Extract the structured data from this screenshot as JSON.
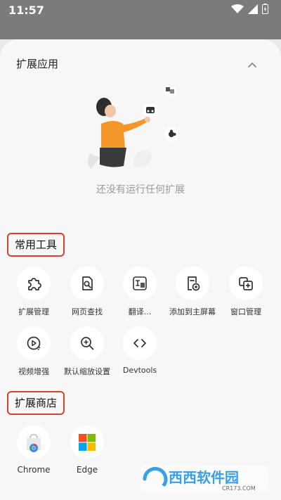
{
  "status": {
    "time": "11:57"
  },
  "panel": {
    "title": "扩展应用",
    "empty_message": "还没有运行任何扩展"
  },
  "common_tools": {
    "title": "常用工具",
    "items": [
      {
        "label": "扩展管理",
        "icon": "puzzle-icon"
      },
      {
        "label": "网页查找",
        "icon": "page-search-icon"
      },
      {
        "label": "翻译...",
        "icon": "translate-icon"
      },
      {
        "label": "添加到主屏幕",
        "icon": "add-to-home-icon"
      },
      {
        "label": "窗口管理",
        "icon": "window-manage-icon"
      },
      {
        "label": "视频增强",
        "icon": "video-enhance-icon"
      },
      {
        "label": "默认缩放设置",
        "icon": "zoom-icon"
      },
      {
        "label": "Devtools",
        "icon": "code-icon"
      }
    ]
  },
  "store": {
    "title": "扩展商店",
    "items": [
      {
        "label": "Chrome",
        "icon": "chrome-store-icon"
      },
      {
        "label": "Edge",
        "icon": "edge-store-icon"
      }
    ]
  },
  "watermark": {
    "text": "西西软件园",
    "sub": "CR173.COM"
  },
  "colors": {
    "highlight_border": "#d9412f",
    "accent_orange": "#f5962b",
    "sheet_background": "#f7f7f7",
    "status_bar": "#7b7b7b"
  }
}
